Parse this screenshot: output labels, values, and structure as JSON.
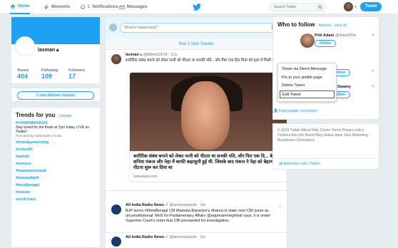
{
  "nav": {
    "home": "Home",
    "moments": "Moments",
    "notifications": "Notifications",
    "notifications_count": "1",
    "messages": "Messages",
    "search_placeholder": "Search Twitter",
    "tweet_button": "Tweet"
  },
  "profile": {
    "name": "laxman",
    "tweets_label": "Tweets",
    "tweets": "404",
    "following_label": "Following",
    "following": "109",
    "followers_label": "Followers",
    "followers": "17",
    "follower_requests": "1 new follower request"
  },
  "trends": {
    "title": "Trends for you",
    "change": "· Change",
    "items": [
      {
        "tag": "#YONOSBI20U20",
        "desc": "Stay tuned for the finals at 7pm today. LIVE on Twitter!",
        "promoted": "Promoted by State Bank of India"
      },
      {
        "tag": "#mondaymorning"
      },
      {
        "tag": "#relive83"
      },
      {
        "tag": "#adimk"
      },
      {
        "tag": "#sensex"
      },
      {
        "tag": "#mamatavsmodi"
      },
      {
        "tag": "#iamandiwill"
      },
      {
        "tag": "#westbengal"
      },
      {
        "tag": "#stocks"
      },
      {
        "tag": "smriti irani"
      }
    ]
  },
  "compose": {
    "placeholder": "What's happening?"
  },
  "stream": {
    "new_tweets": "See 2 new Tweets",
    "tweet1": {
      "name": "laxman",
      "handle": "@lbbisht2014 · 21s",
      "text": "शारीरिक संबंध बनाने को लेकर पत्नी को पीटता था सनकी पति.. और फिर एक दिन पिता को हाल में मिली बेटी",
      "card_title": "शारीरिक संबंध बनाने को लेकर पत्नी को पीटता था सनकी पति, और फिर एक दि... बेटी शनिया पंकज और नेहा में काफी कहासुनी हुई थी. जिसके बाद पंकज ने नेहा को बेहरमी से पीटना शुरू कर दिया था",
      "card_source": "newsstate.com"
    },
    "tweet2": {
      "name": "All India Radio News",
      "handle": "@airnewsalerts · 2m",
      "text": "BJP terms #WestBengal CM Mamata Banerjee's dharna in state over CBI issue as unconstitutional: MoS for Parliamentary Affairs @arjunrammeghwal says, it is under Supreme Court's order that CBI proceeded for investigation."
    },
    "tweet3": {
      "name": "All India Radio News",
      "handle": "@airnewsalerts · 2m"
    }
  },
  "menu": {
    "items": [
      "Share via Direct Message",
      "Pin to your profile page",
      "Delete Tweet",
      "Edit Tweet"
    ],
    "selected": "Edit Tweet"
  },
  "who_to_follow": {
    "title": "Who to follow",
    "links": "· Refresh · View all",
    "suggestions": [
      {
        "name": "Priti Adani",
        "handle": "@AdaniPriti",
        "button": "Follow"
      },
      {
        "name": "",
        "handle": "",
        "button": "Follow"
      },
      {
        "name": "Swamy",
        "handle": "",
        "button": "Follow"
      }
    ],
    "promoted": "Promoted",
    "find_people": "Find people you know"
  },
  "footer": "© 2019 Twitter  About  Help Center  Terms  Privacy policy  Cookies  Ads info  Brand  Blog  Status  Apps  Jobs  Marketing  Businesses  Developers",
  "advertise": "Advertise with Twitter",
  "colors": {
    "accent": "#1da1f2",
    "bg": "#e6ecf0",
    "highlight_border": "#c0392b"
  }
}
